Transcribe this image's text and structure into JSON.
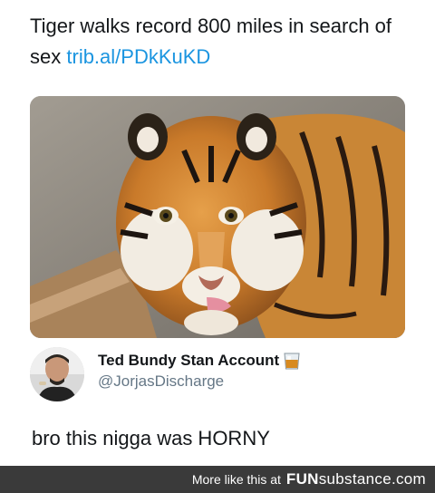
{
  "tweet": {
    "text": "Tiger walks record 800 miles in search of sex",
    "link": "trib.al/PDkKuKD"
  },
  "reply": {
    "display_name": "Ted Bundy Stan Account",
    "name_emoji_icon": "whiskey-glass-icon",
    "handle": "@JorjasDischarge",
    "text": "bro this nigga was HORNY"
  },
  "footer": {
    "more_label": "More like this at",
    "brand_prefix": "FUN",
    "brand_suffix": "substance",
    "brand_tld": ".com"
  },
  "colors": {
    "link": "#1b95e0",
    "handle": "#657786",
    "footer_bg": "#3a3a3a"
  }
}
